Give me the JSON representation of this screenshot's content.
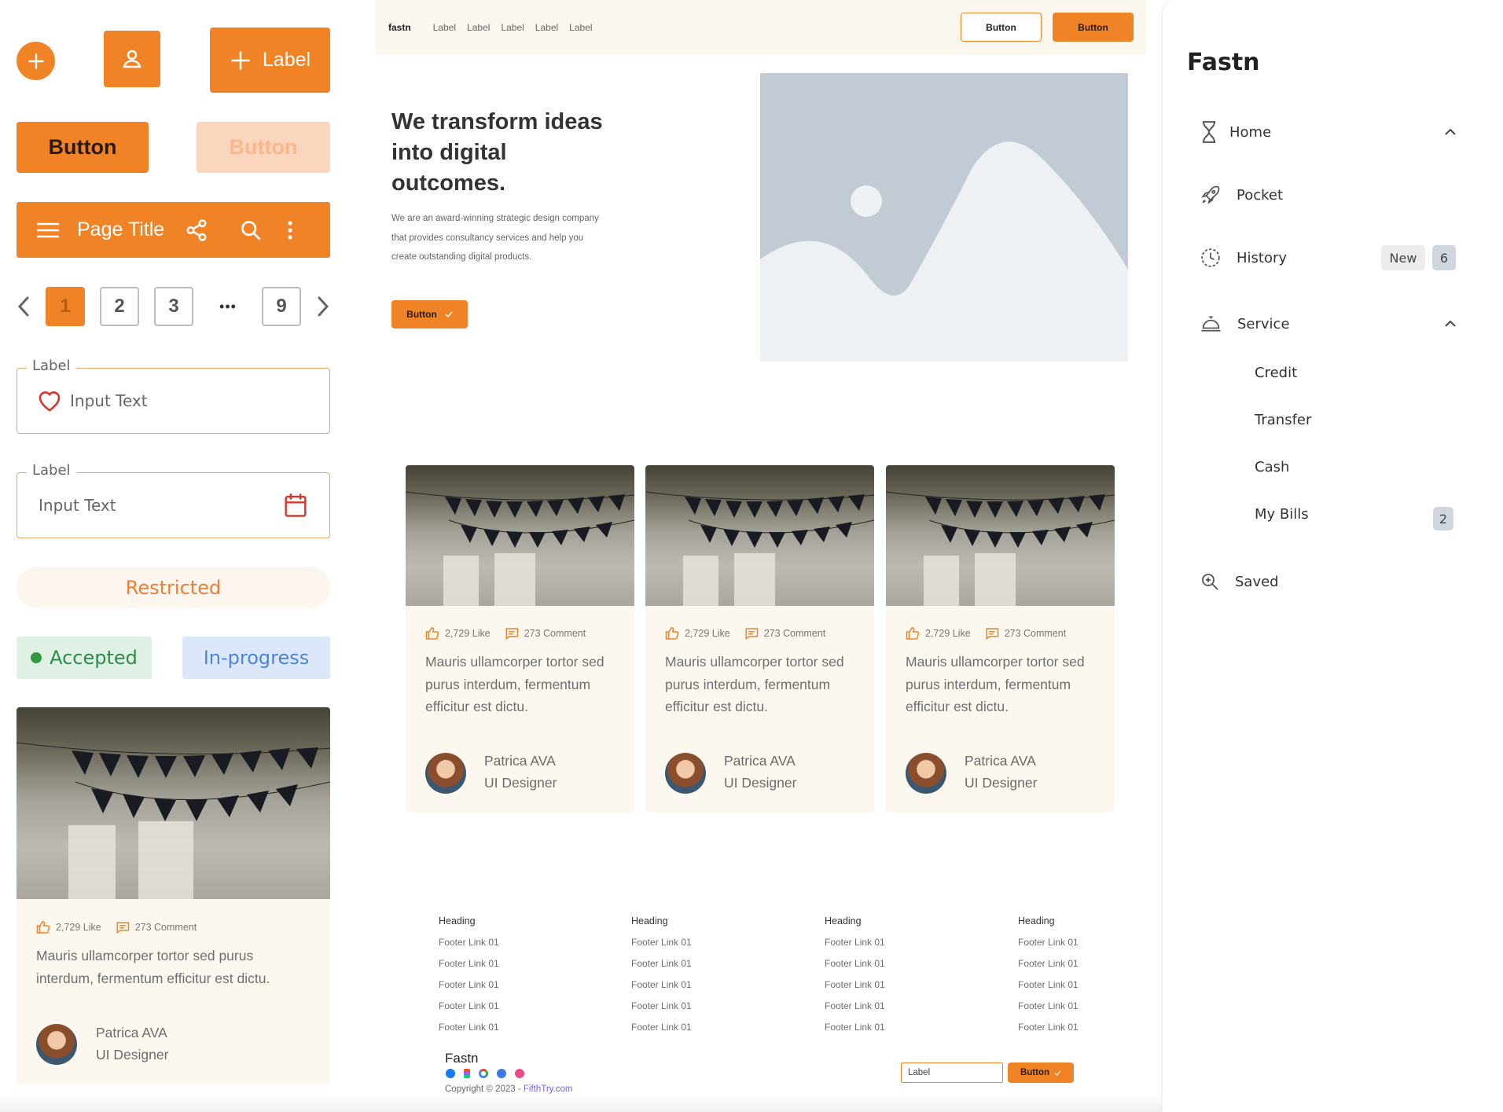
{
  "colors": {
    "accent": "#f08326",
    "accent_soft": "#f9d6bd",
    "cream": "#fdf8ef",
    "accepted_bg": "#dff1e4",
    "accepted_text": "#2f8a4a",
    "progress_bg": "#dce8fa",
    "progress_text": "#4b86d6"
  },
  "components": {
    "fab_icon": "plus-icon",
    "user_icon": "user-icon",
    "label_button": "Label",
    "button_primary": "Button",
    "button_disabled": "Button",
    "toolbar_title": "Page Title",
    "pagination": {
      "pages": [
        "1",
        "2",
        "3"
      ],
      "ellipsis": "•••",
      "last": "9",
      "current": "1"
    },
    "input1": {
      "label": "Label",
      "value": "Input Text"
    },
    "input2": {
      "label": "Label",
      "value": "Input Text"
    },
    "restricted": "Restricted",
    "accepted": "Accepted",
    "in_progress": "In-progress",
    "card": {
      "likes": "2,729 Like",
      "comments": "273 Comment",
      "text": "Mauris ullamcorper tortor sed purus interdum, fermentum efficitur est dictu.",
      "name": "Patrica AVA",
      "role": "UI Designer"
    }
  },
  "navbar": {
    "brand": "fastn",
    "links": [
      "Label",
      "Label",
      "Label",
      "Label",
      "Label"
    ],
    "button_outline": "Button",
    "button_filled": "Button"
  },
  "hero": {
    "heading": "We transform ideas into digital outcomes.",
    "body": "We are an award-winning strategic design company that provides consultancy services and help you create outstanding digital products.",
    "button": "Button"
  },
  "cards": [
    {
      "likes": "2,729 Like",
      "comments": "273 Comment",
      "text": "Mauris ullamcorper tortor sed purus interdum, fermentum efficitur est dictu.",
      "name": "Patrica AVA",
      "role": "UI Designer"
    },
    {
      "likes": "2,729 Like",
      "comments": "273 Comment",
      "text": "Mauris ullamcorper tortor sed purus interdum, fermentum efficitur est dictu.",
      "name": "Patrica AVA",
      "role": "UI Designer"
    },
    {
      "likes": "2,729 Like",
      "comments": "273 Comment",
      "text": "Mauris ullamcorper tortor sed purus interdum, fermentum efficitur est dictu.",
      "name": "Patrica AVA",
      "role": "UI Designer"
    }
  ],
  "footer": {
    "columns": [
      {
        "heading": "Heading",
        "links": [
          "Footer Link 01",
          "Footer Link 01",
          "Footer Link 01",
          "Footer Link 01",
          "Footer Link 01"
        ]
      },
      {
        "heading": "Heading",
        "links": [
          "Footer Link 01",
          "Footer Link 01",
          "Footer Link 01",
          "Footer Link 01",
          "Footer Link 01"
        ]
      },
      {
        "heading": "Heading",
        "links": [
          "Footer Link 01",
          "Footer Link 01",
          "Footer Link 01",
          "Footer Link 01",
          "Footer Link 01"
        ]
      },
      {
        "heading": "Heading",
        "links": [
          "Footer Link 01",
          "Footer Link 01",
          "Footer Link 01",
          "Footer Link 01",
          "Footer Link 01"
        ]
      }
    ],
    "brand": "Fastn",
    "copyright": "Copyright © 2023 - ",
    "copyright_link": "FifthTry.com",
    "input_placeholder": "Label",
    "button": "Button"
  },
  "sidebar": {
    "title": "Fastn",
    "items": [
      {
        "label": "Home",
        "icon": "hourglass-icon"
      },
      {
        "label": "Pocket",
        "icon": "rocket-icon"
      },
      {
        "label": "History",
        "icon": "clock-icon",
        "badge_new": "New",
        "badge_count": "6"
      },
      {
        "label": "Service",
        "icon": "service-bell-icon"
      },
      {
        "label": "Saved",
        "icon": "search-zoom-icon"
      }
    ],
    "sub_items": [
      {
        "label": "Credit"
      },
      {
        "label": "Transfer"
      },
      {
        "label": "Cash"
      },
      {
        "label": "My Bills",
        "badge": "2"
      }
    ]
  }
}
